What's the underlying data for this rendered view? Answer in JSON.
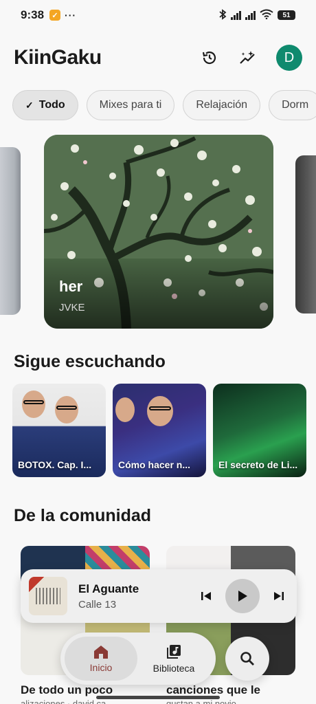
{
  "status": {
    "time": "9:38",
    "dots": "···",
    "battery": "51"
  },
  "header": {
    "title": "KiinGaku",
    "avatar_letter": "D"
  },
  "chips": [
    {
      "label": "Todo",
      "active": true
    },
    {
      "label": "Mixes para ti",
      "active": false
    },
    {
      "label": "Relajación",
      "active": false
    },
    {
      "label": "Dorm",
      "active": false
    }
  ],
  "hero": {
    "title": "her",
    "artist": "JVKE"
  },
  "sections": {
    "keep_listening": "Sigue escuchando",
    "community": "De la comunidad"
  },
  "keep_listening": [
    {
      "label": "BOTOX. Cap. I..."
    },
    {
      "label": "Cómo hacer n..."
    },
    {
      "label": "El secreto de Li..."
    }
  ],
  "community": [
    {
      "title": "De todo un poco",
      "subtitle": "alizaciones · david ca"
    },
    {
      "title": "canciones que le",
      "subtitle": "gustan a mi novio"
    }
  ],
  "player": {
    "song": "El Aguante",
    "artist": "Calle 13"
  },
  "nav": {
    "home": "Inicio",
    "library": "Biblioteca"
  },
  "colors": {
    "avatar": "#0f8a6e",
    "active_nav": "#8a3a35"
  }
}
